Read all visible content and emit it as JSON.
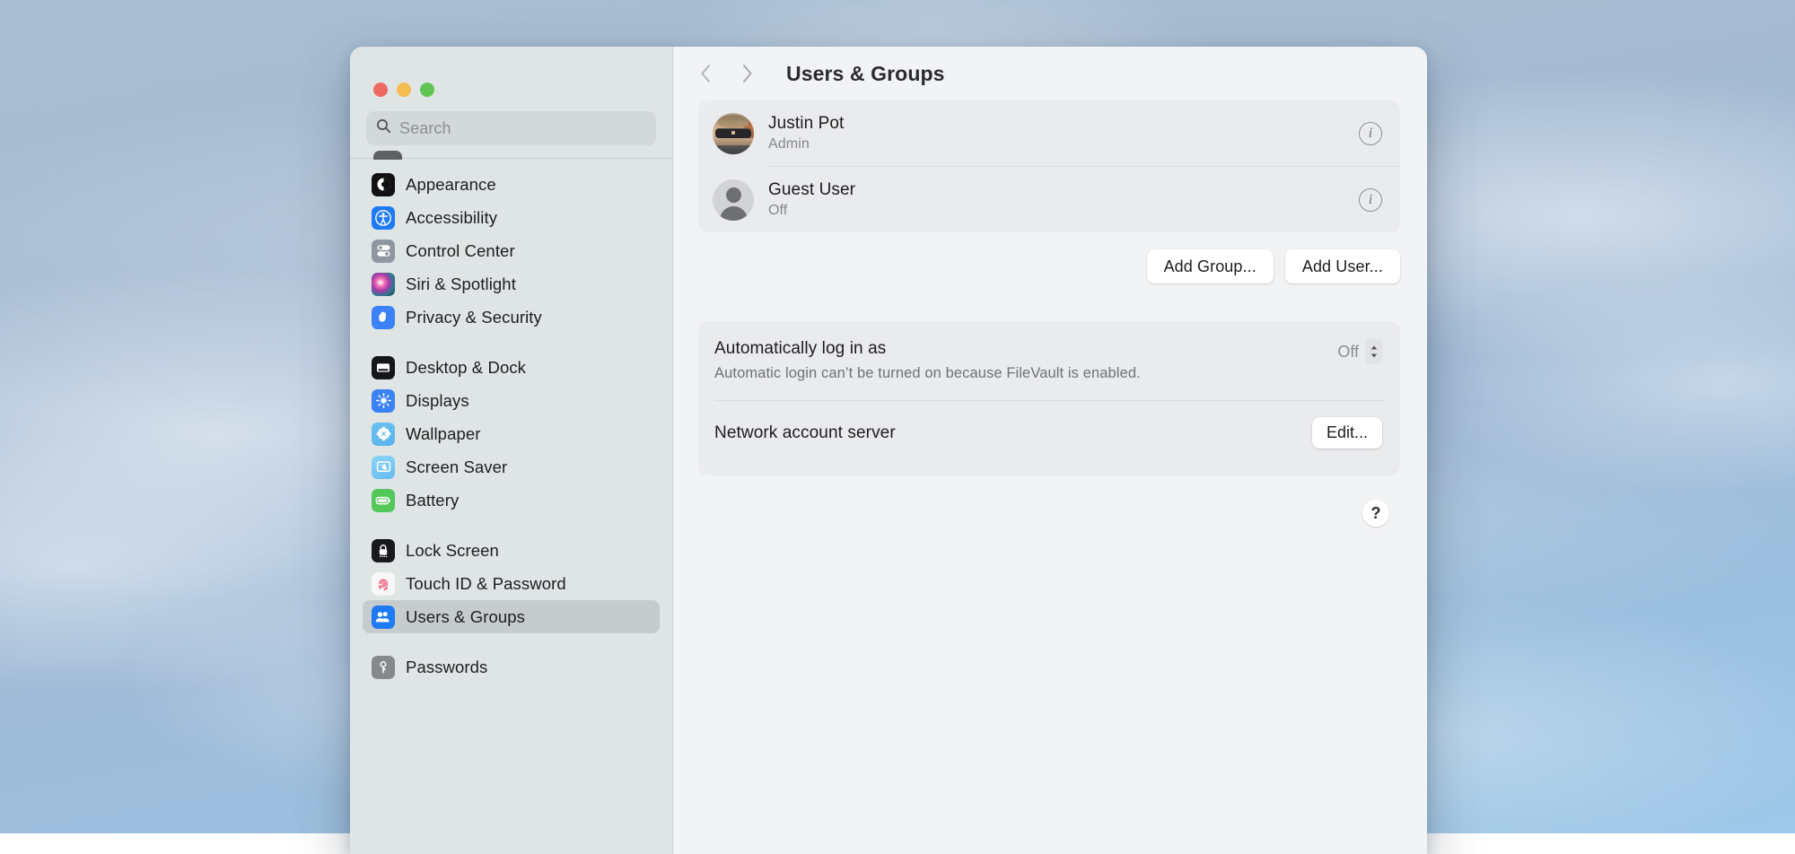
{
  "window": {
    "traffic_lights": [
      "close",
      "minimize",
      "zoom"
    ],
    "colors": {
      "close": "#ec6a5f",
      "minimize": "#f4bd50",
      "zoom": "#61c554",
      "accent": "#1e7bf5"
    }
  },
  "sidebar": {
    "search": {
      "placeholder": "Search",
      "value": ""
    },
    "groups": [
      {
        "items": [
          {
            "label": "Appearance",
            "icon": "appearance-icon",
            "selected": false
          },
          {
            "label": "Accessibility",
            "icon": "accessibility-icon",
            "selected": false
          },
          {
            "label": "Control Center",
            "icon": "control-center-icon",
            "selected": false
          },
          {
            "label": "Siri & Spotlight",
            "icon": "siri-icon",
            "selected": false
          },
          {
            "label": "Privacy & Security",
            "icon": "privacy-hand-icon",
            "selected": false
          }
        ]
      },
      {
        "items": [
          {
            "label": "Desktop & Dock",
            "icon": "desktop-dock-icon",
            "selected": false
          },
          {
            "label": "Displays",
            "icon": "displays-icon",
            "selected": false
          },
          {
            "label": "Wallpaper",
            "icon": "wallpaper-icon",
            "selected": false
          },
          {
            "label": "Screen Saver",
            "icon": "screen-saver-icon",
            "selected": false
          },
          {
            "label": "Battery",
            "icon": "battery-icon",
            "selected": false
          }
        ]
      },
      {
        "items": [
          {
            "label": "Lock Screen",
            "icon": "lock-icon",
            "selected": false
          },
          {
            "label": "Touch ID & Password",
            "icon": "touch-id-icon",
            "selected": false
          },
          {
            "label": "Users & Groups",
            "icon": "users-icon",
            "selected": true
          }
        ]
      },
      {
        "items": [
          {
            "label": "Passwords",
            "icon": "passwords-key-icon",
            "selected": false
          }
        ]
      }
    ]
  },
  "toolbar": {
    "back_icon": "chevron-left-icon",
    "forward_icon": "chevron-right-icon",
    "title": "Users & Groups"
  },
  "users": [
    {
      "name": "Justin Pot",
      "status": "Admin",
      "avatar": "photo",
      "info_icon": "info-icon"
    },
    {
      "name": "Guest User",
      "status": "Off",
      "avatar": "generic",
      "info_icon": "info-icon"
    }
  ],
  "actions": {
    "add_group": "Add Group...",
    "add_user": "Add User..."
  },
  "settings": {
    "auto_login": {
      "label": "Automatically log in as",
      "value": "Off",
      "description": "Automatic login can’t be turned on because FileVault is enabled."
    },
    "network_account_server": {
      "label": "Network account server",
      "edit_label": "Edit..."
    }
  },
  "help": {
    "label": "?",
    "icon": "question-mark-icon"
  }
}
